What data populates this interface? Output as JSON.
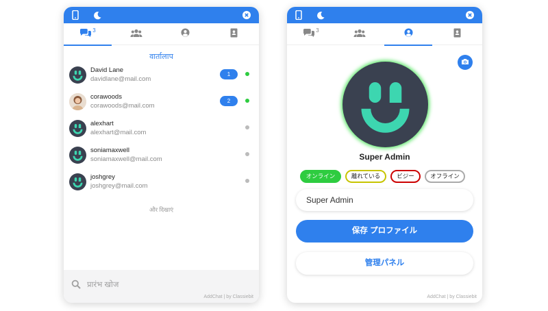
{
  "colors": {
    "accent": "#2f80ed",
    "online": "#2ecc40",
    "offline": "#bbbbbb",
    "away": "#c7c400",
    "busy": "#cc0000",
    "avatar_bg": "#3a4150",
    "avatar_face": "#3dd6b0"
  },
  "left": {
    "tabs": [
      {
        "icon": "chat-bubbles-icon",
        "count": "3"
      },
      {
        "icon": "users-icon"
      },
      {
        "icon": "user-profile-icon"
      },
      {
        "icon": "contact-book-icon"
      }
    ],
    "section_title": "वार्तालाप",
    "contacts": [
      {
        "name": "David Lane",
        "email": "davidlane@mail.com",
        "unread": "1",
        "status": "online"
      },
      {
        "name": "corawoods",
        "email": "corawoods@mail.com",
        "unread": "2",
        "status": "online"
      },
      {
        "name": "alexhart",
        "email": "alexhart@mail.com",
        "status": "offline"
      },
      {
        "name": "soniamaxwell",
        "email": "soniamaxwell@mail.com",
        "status": "offline"
      },
      {
        "name": "joshgrey",
        "email": "joshgrey@mail.com",
        "status": "offline"
      }
    ],
    "show_more": "और दिखाएं",
    "search_placeholder": "प्रारंभ खोज",
    "credit": "AddChat | by Classiebit"
  },
  "right": {
    "tabs": [
      {
        "icon": "chat-bubbles-icon",
        "count": "3"
      },
      {
        "icon": "users-icon"
      },
      {
        "icon": "user-profile-icon"
      },
      {
        "icon": "contact-book-icon"
      }
    ],
    "user_name": "Super Admin",
    "statuses": [
      "オンライン",
      "離れている",
      "ビジー",
      "オフライン"
    ],
    "name_field_value": "Super Admin",
    "save_label": "保存 プロファイル",
    "admin_label": "管理パネル",
    "credit": "AddChat | by Classiebit"
  }
}
